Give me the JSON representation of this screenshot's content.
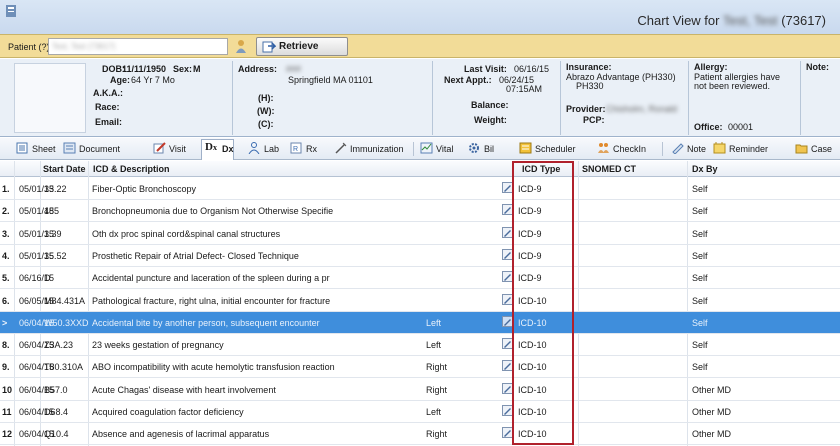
{
  "window": {
    "title_prefix": "Chart View for",
    "patient_name_hidden": "Test, Test",
    "patient_id": "(73617)"
  },
  "patient_bar": {
    "label": "Patient (?)",
    "input_value": "Test, Test (73617)",
    "retrieve_label": "Retrieve"
  },
  "demographics": {
    "dob_label": "DOB:",
    "dob": "11/11/1950",
    "sex_label": "Sex:",
    "sex": "M",
    "age_label": "Age:",
    "age": "64 Yr 7 Mo",
    "aka_label": "A.K.A.:",
    "race_label": "Race:",
    "email_label": "Email:",
    "address_label": "Address:",
    "address_line1": "###",
    "address_city": "Springfield  MA  01101",
    "phone_h_label": "(H):",
    "phone_w_label": "(W):",
    "phone_c_label": "(C):",
    "last_visit_label": "Last Visit:",
    "last_visit": "06/16/15",
    "next_appt_label": "Next Appt.:",
    "next_appt": "06/24/15",
    "next_appt_time": "07:15AM",
    "balance_label": "Balance:",
    "weight_label": "Weight:",
    "insurance_label": "Insurance:",
    "insurance_line1": "Abrazo Advantage  (PH330)",
    "insurance_line2": "PH330",
    "provider_label": "Provider:",
    "provider_value": "Chisholm, Ronald",
    "pcp_label": "PCP:",
    "allergy_label": "Allergy:",
    "allergy_line1": "Patient allergies have",
    "allergy_line2": "not been reviewed.",
    "office_label": "Office:",
    "office": "00001",
    "note_label": "Note:"
  },
  "toolbar": {
    "sheet": "Sheet",
    "document": "Document",
    "visit": "Visit",
    "dx": "Dx",
    "lab": "Lab",
    "rx": "Rx",
    "immunization": "Immunization",
    "vital": "Vital",
    "bil": "Bil",
    "scheduler": "Scheduler",
    "checkin": "CheckIn",
    "note": "Note",
    "reminder": "Reminder",
    "case": "Case"
  },
  "grid": {
    "headers": {
      "start_date": "Start Date",
      "icd_desc": "ICD & Description",
      "icd_type": "ICD Type",
      "snomed": "SNOMED CT",
      "dx_by": "Dx By"
    },
    "rows": [
      {
        "num": "1.",
        "date": "05/01/15",
        "code": "33.22",
        "desc": "Fiber-Optic Bronchoscopy",
        "side": "",
        "type": "ICD-9",
        "snomed": "",
        "by": "Self"
      },
      {
        "num": "2.",
        "date": "05/01/15",
        "code": "485",
        "desc": "Bronchopneumonia due to Organism Not Otherwise Specifie",
        "side": "",
        "type": "ICD-9",
        "snomed": "",
        "by": "Self"
      },
      {
        "num": "3.",
        "date": "05/01/15",
        "code": "3.39",
        "desc": "Oth dx proc spinal cord&spinal canal structures",
        "side": "",
        "type": "ICD-9",
        "snomed": "",
        "by": "Self"
      },
      {
        "num": "4.",
        "date": "05/01/15",
        "code": "35.52",
        "desc": "Prosthetic Repair of Atrial Defect- Closed Technique",
        "side": "",
        "type": "ICD-9",
        "snomed": "",
        "by": "Self"
      },
      {
        "num": "5.",
        "date": "06/16/15",
        "code": "D",
        "desc": "Accidental puncture and laceration of the spleen during a pr",
        "side": "",
        "type": "ICD-9",
        "snomed": "",
        "by": "Self"
      },
      {
        "num": "6.",
        "date": "06/05/15",
        "code": "M84.431A",
        "desc": "Pathological fracture, right ulna, initial encounter for fracture",
        "side": "",
        "type": "ICD-10",
        "snomed": "",
        "by": "Self"
      },
      {
        "num": ">",
        "date": "06/04/15",
        "code": "W50.3XXD",
        "desc": "Accidental bite by another person, subsequent encounter",
        "side": "Left",
        "type": "ICD-10",
        "snomed": "",
        "by": "Self"
      },
      {
        "num": "8.",
        "date": "06/04/15",
        "code": "Z3A.23",
        "desc": "23 weeks gestation of pregnancy",
        "side": "Left",
        "type": "ICD-10",
        "snomed": "",
        "by": "Self"
      },
      {
        "num": "9.",
        "date": "06/04/15",
        "code": "T80.310A",
        "desc": "ABO incompatibility with acute hemolytic transfusion reaction",
        "side": "Right",
        "type": "ICD-10",
        "snomed": "",
        "by": "Self"
      },
      {
        "num": "10",
        "date": "06/04/15",
        "code": "B57.0",
        "desc": "Acute Chagas' disease with heart involvement",
        "side": "Right",
        "type": "ICD-10",
        "snomed": "",
        "by": "Other MD"
      },
      {
        "num": "11",
        "date": "06/04/15",
        "code": "D68.4",
        "desc": "Acquired coagulation factor deficiency",
        "side": "Left",
        "type": "ICD-10",
        "snomed": "",
        "by": "Other MD"
      },
      {
        "num": "12",
        "date": "06/04/15",
        "code": "Q10.4",
        "desc": "Absence and agenesis of lacrimal apparatus",
        "side": "Right",
        "type": "ICD-10",
        "snomed": "",
        "by": "Other MD"
      }
    ]
  },
  "colors": {
    "selected_row": "#3f8edc",
    "highlight_box": "#b0212c",
    "patient_bar": "#f2dc98"
  }
}
